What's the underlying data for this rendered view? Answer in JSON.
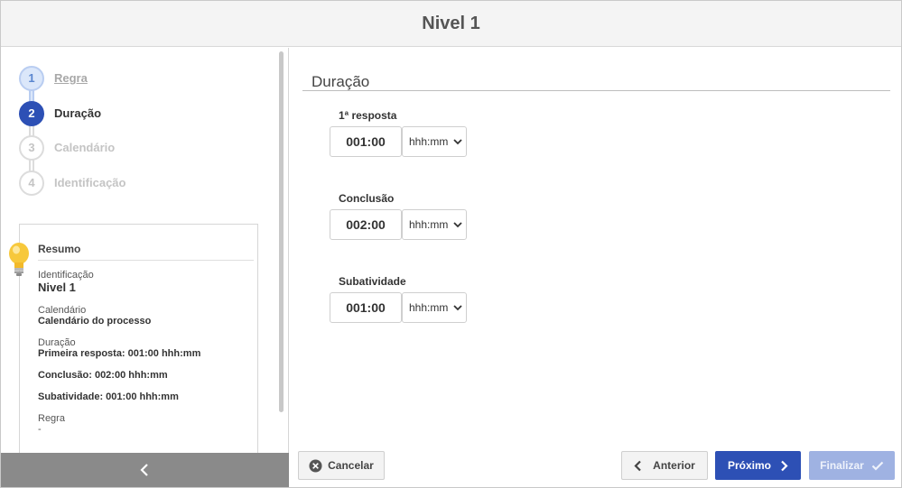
{
  "header": {
    "title": "Nivel 1"
  },
  "wizard": {
    "steps": [
      {
        "number": "1",
        "label": "Regra",
        "state": "done"
      },
      {
        "number": "2",
        "label": "Duração",
        "state": "active"
      },
      {
        "number": "3",
        "label": "Calendário",
        "state": "pending"
      },
      {
        "number": "4",
        "label": "Identificação",
        "state": "pending"
      }
    ]
  },
  "summary": {
    "title": "Resumo",
    "identificacao_label": "Identificação",
    "identificacao_value": "Nivel 1",
    "calendario_label": "Calendário",
    "calendario_value": "Calendário do processo",
    "duracao_label": "Duração",
    "primeira_resposta": "Primeira resposta: 001:00 hhh:mm",
    "conclusao": "Conclusão: 002:00 hhh:mm",
    "subatividade": "Subatividade: 001:00 hhh:mm",
    "regra_label": "Regra",
    "regra_value": "-"
  },
  "main": {
    "section_title": "Duração",
    "fields": [
      {
        "label": "1ª resposta",
        "value": "001:00",
        "unit": "hhh:mm"
      },
      {
        "label": "Conclusão",
        "value": "002:00",
        "unit": "hhh:mm"
      },
      {
        "label": "Subatividade",
        "value": "001:00",
        "unit": "hhh:mm"
      }
    ]
  },
  "footer": {
    "cancel_label": "Cancelar",
    "prev_label": "Anterior",
    "next_label": "Próximo",
    "finish_label": "Finalizar"
  },
  "colors": {
    "primary": "#2d50b5",
    "primary_disabled": "#9fb2e2",
    "sidebar_collapse": "#8a8a8a",
    "header_bg": "#f4f4f4"
  }
}
